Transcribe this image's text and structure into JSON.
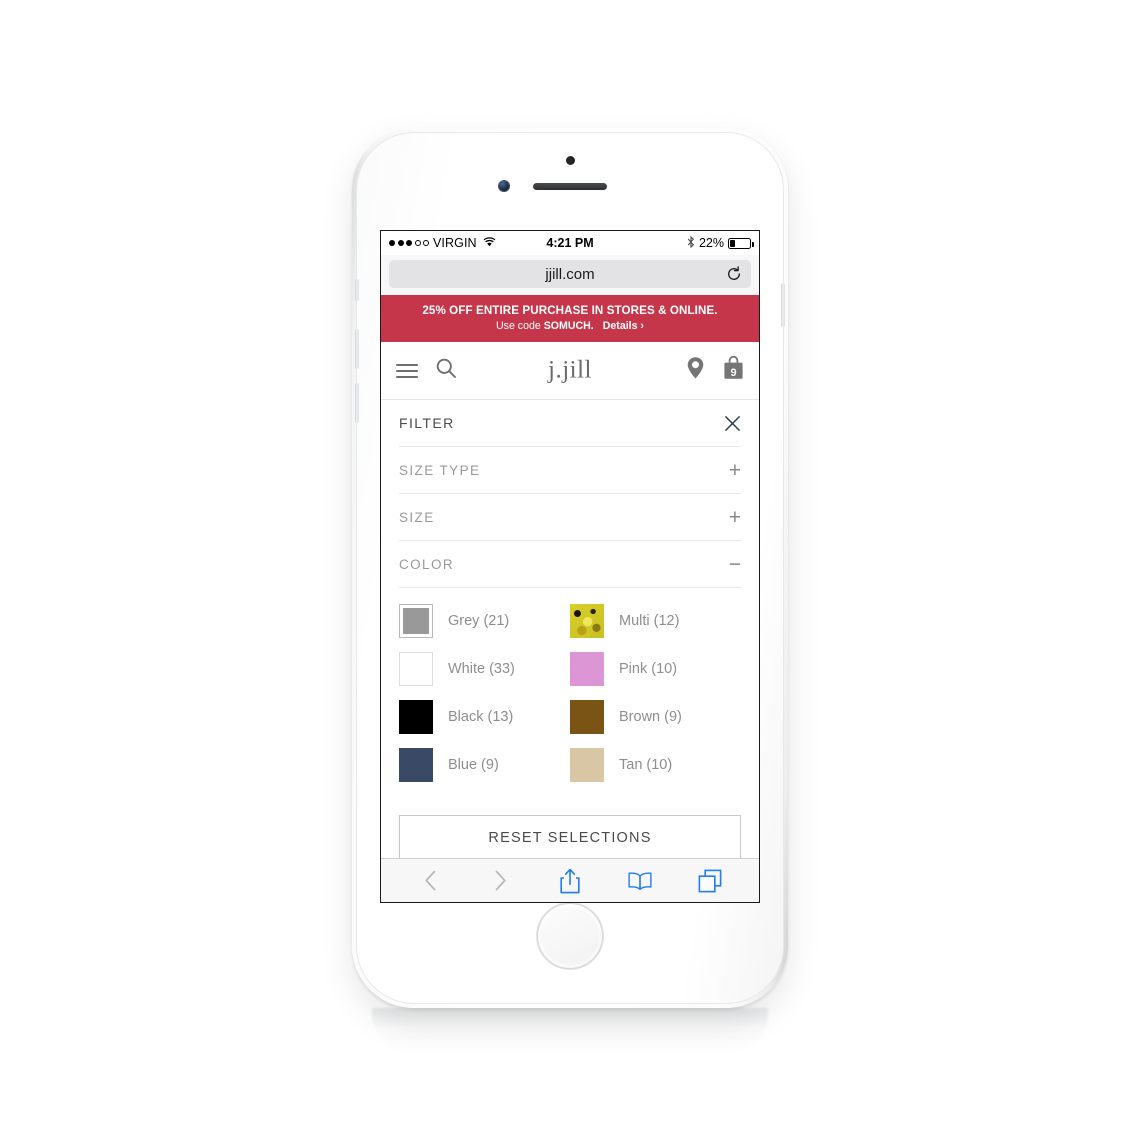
{
  "device": {
    "name": "iphone-white-silver"
  },
  "status_bar": {
    "signal_dots_filled": 3,
    "signal_dots_empty": 2,
    "carrier": "VIRGIN",
    "wifi_icon": "wifi-icon",
    "time": "4:21 PM",
    "bluetooth_icon": "bluetooth-icon",
    "battery_percent": "22%",
    "battery_level": 22
  },
  "browser": {
    "url": "jjill.com",
    "reload_icon": "reload-icon",
    "bottom_bar": {
      "back_icon": "back-chevron-icon",
      "forward_icon": "forward-chevron-icon",
      "share_icon": "share-icon",
      "bookmarks_icon": "bookmarks-icon",
      "tabs_icon": "tabs-icon",
      "accent_color": "#1f7cf2",
      "disabled_color": "#b7b7b7"
    }
  },
  "promo": {
    "line1": "25% OFF ENTIRE PURCHASE IN STORES & ONLINE.",
    "line2_prefix": "Use code ",
    "code": "SOMUCH.",
    "details": "Details ›",
    "background_color": "#c6364a"
  },
  "site_header": {
    "menu_icon": "hamburger-menu-icon",
    "search_icon": "search-icon",
    "logo_text": "j.jill",
    "store_locator_icon": "location-pin-icon",
    "bag_icon": "shopping-bag-icon",
    "bag_count": "9"
  },
  "filter": {
    "title": "FILTER",
    "close_icon": "close-x-icon",
    "sections": [
      {
        "label": "SIZE TYPE",
        "state": "collapsed",
        "sign": "+"
      },
      {
        "label": "SIZE",
        "state": "collapsed",
        "sign": "+"
      },
      {
        "label": "COLOR",
        "state": "expanded",
        "sign": "−"
      }
    ],
    "colors": [
      {
        "name": "Grey",
        "label": "Grey (21)",
        "count": 21,
        "swatch": "#999999",
        "selected": true,
        "bordered": false,
        "pattern": false
      },
      {
        "name": "Multi",
        "label": "Multi (12)",
        "count": 12,
        "swatch": "#d8cf2a",
        "selected": false,
        "bordered": false,
        "pattern": true
      },
      {
        "name": "White",
        "label": "White (33)",
        "count": 33,
        "swatch": "#ffffff",
        "selected": false,
        "bordered": true,
        "pattern": false
      },
      {
        "name": "Pink",
        "label": "Pink (10)",
        "count": 10,
        "swatch": "#dc96d6",
        "selected": false,
        "bordered": false,
        "pattern": false
      },
      {
        "name": "Black",
        "label": "Black (13)",
        "count": 13,
        "swatch": "#000000",
        "selected": false,
        "bordered": false,
        "pattern": false
      },
      {
        "name": "Brown",
        "label": "Brown (9)",
        "count": 9,
        "swatch": "#7a5414",
        "selected": false,
        "bordered": false,
        "pattern": false
      },
      {
        "name": "Blue",
        "label": "Blue (9)",
        "count": 9,
        "swatch": "#3a4a66",
        "selected": false,
        "bordered": false,
        "pattern": false
      },
      {
        "name": "Tan",
        "label": "Tan (10)",
        "count": 10,
        "swatch": "#d9c6a4",
        "selected": false,
        "bordered": false,
        "pattern": false
      }
    ],
    "reset_label": "RESET SELECTIONS"
  }
}
